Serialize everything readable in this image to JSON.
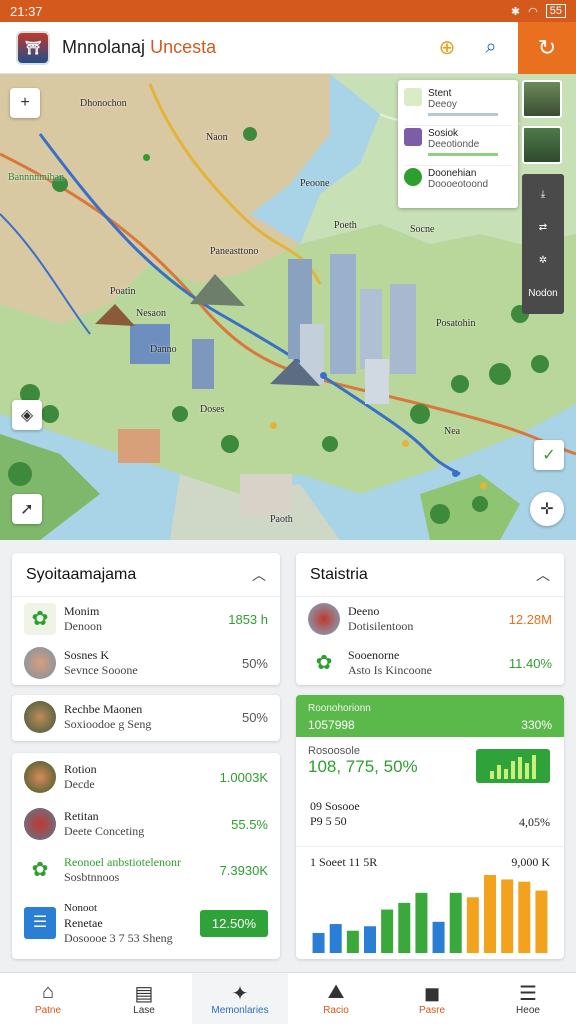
{
  "status": {
    "time": "21:37",
    "battery": "55"
  },
  "app": {
    "title_main": "Mnnolanaj",
    "title_accent": "Uncesta"
  },
  "map": {
    "labels": [
      {
        "text": "Dhonochon"
      },
      {
        "text": "Naon"
      },
      {
        "text": "Bannnnmiban"
      },
      {
        "text": "Peoone"
      },
      {
        "text": "Paneasttono"
      },
      {
        "text": "Poeth"
      },
      {
        "text": "Socne"
      },
      {
        "text": "Nesaon"
      },
      {
        "text": "Danno"
      },
      {
        "text": "Posatohin"
      },
      {
        "text": "Doses"
      },
      {
        "text": "Paoth"
      },
      {
        "text": "Nea"
      },
      {
        "text": "Poatin"
      }
    ],
    "legend": [
      {
        "title": "Stent",
        "sub": "Deeoy",
        "color": "#4caf50"
      },
      {
        "title": "Sosiok",
        "sub": "Deeotionde",
        "color": "#7b5ea7"
      },
      {
        "title": "Doonehian",
        "sub": "Doooeotoond",
        "color": "#2e9e2e"
      }
    ],
    "tool_label": "Nodon"
  },
  "left_card": {
    "title": "Syoitaamajama",
    "items": [
      {
        "title": "Monim",
        "sub": "Denoon",
        "value": "1853 h",
        "color": "green"
      },
      {
        "title": "Sosnes K",
        "sub": "Sevnce Sooone",
        "value": "50%",
        "color": "grey"
      }
    ]
  },
  "left_card2": {
    "items": [
      {
        "title": "Rechbe Maonen",
        "sub": "Soxioodoe g Seng",
        "value": "50%",
        "color": "grey"
      }
    ]
  },
  "left_card3": {
    "items": [
      {
        "title": "Rotion",
        "sub": "Decde",
        "value": "1.0003K",
        "color": "green"
      },
      {
        "title": "Retitan",
        "sub": "Deete Conceting",
        "value": "55.5%",
        "color": "green"
      },
      {
        "title": "Reonoel anbstiotelenonr",
        "sub": "Sosbtnnoos",
        "value": "7.3930K",
        "color": "green"
      },
      {
        "title": "Nonoot",
        "title2": "Renetae",
        "sub": "Dosoooe 3 7 53 Sheng",
        "value": "12.50%",
        "color": "badge"
      }
    ]
  },
  "right_card": {
    "title": "Staistria",
    "items": [
      {
        "title": "Deeno",
        "sub": "Dotisilentoon",
        "value": "12.28M",
        "color": "orange"
      },
      {
        "title": "Sooenorne",
        "sub": "Asto Is Kincoone",
        "value": "11.40%",
        "color": "green"
      }
    ]
  },
  "right_card2": {
    "header_top": "Roonohorionn",
    "header_value": "1057998",
    "header_pct": "330%",
    "big_label": "Rosoosole",
    "big_value": "108, 775, 50%",
    "row1_label": "09 Sosooe",
    "row1_sub": "P9 5 50",
    "row1_value": "4,05%",
    "row2_label": "1 Soeet 11 5R",
    "row2_value": "9,000 K",
    "chart_data": {
      "type": "bar",
      "values": [
        18,
        26,
        20,
        24,
        39,
        45,
        54,
        28,
        54,
        50,
        70,
        66,
        64,
        56
      ],
      "colors": [
        "#2a7fd4",
        "#2a7fd4",
        "#3aa83a",
        "#2a7fd4",
        "#3aa83a",
        "#3aa83a",
        "#3aa83a",
        "#2a7fd4",
        "#3aa83a",
        "#f2a21c",
        "#f2a21c",
        "#f2a21c",
        "#f2a21c",
        "#f2a21c"
      ]
    }
  },
  "nav": [
    {
      "label": "Patne",
      "icon": "⌂"
    },
    {
      "label": "Lase",
      "icon": "▤"
    },
    {
      "label": "Memonlaries",
      "icon": "✦"
    },
    {
      "label": "Racio",
      "icon": "⛰"
    },
    {
      "label": "Pasre",
      "icon": "◼"
    },
    {
      "label": "Heoe",
      "icon": "☰"
    }
  ]
}
